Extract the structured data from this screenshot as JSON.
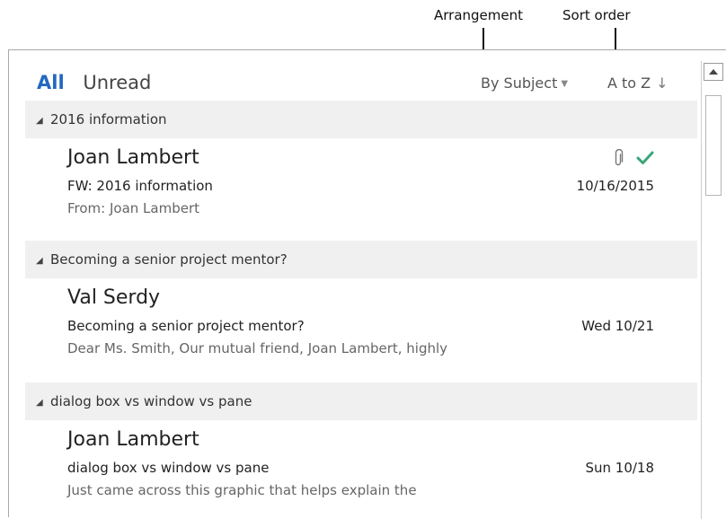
{
  "callouts": {
    "arrangement": "Arrangement",
    "sort_order": "Sort order"
  },
  "filters": {
    "all": "All",
    "unread": "Unread"
  },
  "toolbar": {
    "arrange_by": "By Subject",
    "sort": "A to Z",
    "sort_arrow": "↓",
    "caret": "▼"
  },
  "groups": [
    {
      "header": "2016 information",
      "item": {
        "sender": "Joan Lambert",
        "subject": "FW: 2016 information",
        "preview": "From: Joan Lambert",
        "date": "10/16/2015",
        "has_attachment": true,
        "flag_complete": true
      }
    },
    {
      "header": "Becoming a senior project mentor?",
      "item": {
        "sender": "Val Serdy",
        "subject": "Becoming a senior project mentor?",
        "preview": "Dear Ms. Smith,  Our mutual friend, Joan Lambert, highly",
        "date": "Wed 10/21"
      }
    },
    {
      "header": "dialog box vs window vs pane",
      "item": {
        "sender": "Joan Lambert",
        "subject": "dialog box vs window vs pane",
        "preview": "Just came across this graphic that helps explain the",
        "date": "Sun 10/18"
      }
    }
  ],
  "colors": {
    "accent": "#2168c0",
    "check": "#3aa57a",
    "group_bg": "#f0f0f0"
  },
  "icons": {
    "group_toggle": "collapse-triangle-icon",
    "attachment": "paperclip-icon",
    "completed": "checkmark-icon",
    "scroll_up": "scroll-up-arrow-icon"
  }
}
